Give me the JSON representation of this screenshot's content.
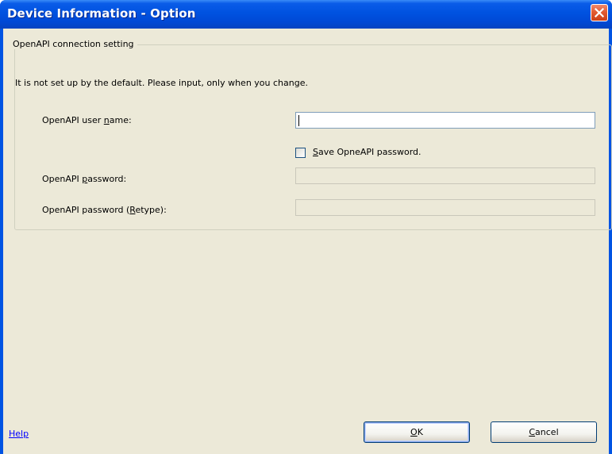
{
  "window": {
    "title": "Device Information - Option"
  },
  "group": {
    "legend": "OpenAPI connection setting",
    "description": "It is not set up by the default. Please input, only when you change."
  },
  "fields": {
    "username": {
      "label_pre": "OpenAPI user ",
      "label_accel": "n",
      "label_post": "ame:",
      "value": ""
    },
    "save_password": {
      "label_accel": "S",
      "label_post": "ave OpneAPI password.",
      "checked": false
    },
    "password": {
      "label_pre": "OpenAPI ",
      "label_accel": "p",
      "label_post": "assword:",
      "value": ""
    },
    "password_retype": {
      "label_pre": "OpenAPI password (",
      "label_accel": "R",
      "label_post": "etype):",
      "value": ""
    }
  },
  "footer": {
    "help": "Help",
    "ok_accel": "O",
    "ok_post": "K",
    "cancel_accel": "C",
    "cancel_post": "ancel"
  },
  "colors": {
    "titlebar": "#0054e3",
    "dialog_face": "#ece9d8",
    "close_button": "#e25b33",
    "link": "#0000ff"
  },
  "icons": {
    "close": "close-icon"
  }
}
